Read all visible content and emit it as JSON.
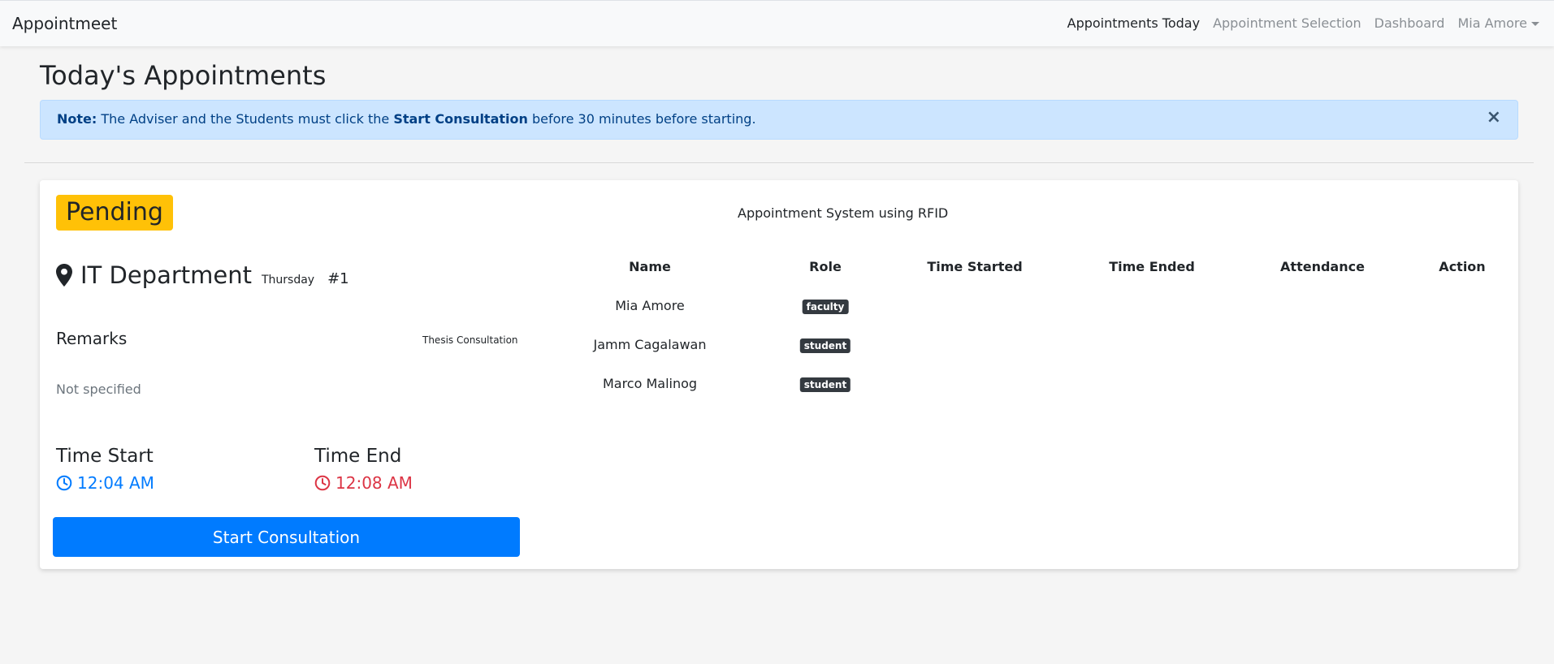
{
  "navbar": {
    "brand": "Appointmeet",
    "links": [
      {
        "label": "Appointments Today",
        "active": true
      },
      {
        "label": "Appointment Selection",
        "active": false
      },
      {
        "label": "Dashboard",
        "active": false
      }
    ],
    "user_menu": "Mia Amore"
  },
  "page": {
    "title": "Today's Appointments"
  },
  "alert": {
    "prefix": "Note:",
    "text_1": " The Adviser and the Students must click the ",
    "emphasis": "Start Consultation",
    "text_2": " before 30 minutes before starting.",
    "close": "×"
  },
  "appointment": {
    "status": "Pending",
    "title": "Appointment System using RFID",
    "location": "IT Department",
    "day": "Thursday",
    "number": "#1",
    "remarks_label": "Remarks",
    "remarks_type": "Thesis Consultation",
    "remarks_value": "Not specified",
    "time_start_label": "Time Start",
    "time_start": "12:04 AM",
    "time_end_label": "Time End",
    "time_end": "12:08 AM",
    "start_button": "Start Consultation"
  },
  "participants": {
    "columns": [
      "Name",
      "Role",
      "Time Started",
      "Time Ended",
      "Attendance",
      "Action"
    ],
    "rows": [
      {
        "name": "Mia Amore",
        "role": "faculty"
      },
      {
        "name": "Jamm Cagalawan",
        "role": "student"
      },
      {
        "name": "Marco Malinog",
        "role": "student"
      }
    ]
  },
  "colors": {
    "primary": "#007bff",
    "danger": "#dc3545",
    "warning": "#ffc107",
    "info_bg": "#cce5ff",
    "dark_badge": "#343a40"
  },
  "icons": [
    "map-marker-icon",
    "clock-icon",
    "close-icon",
    "caret-down-icon"
  ]
}
